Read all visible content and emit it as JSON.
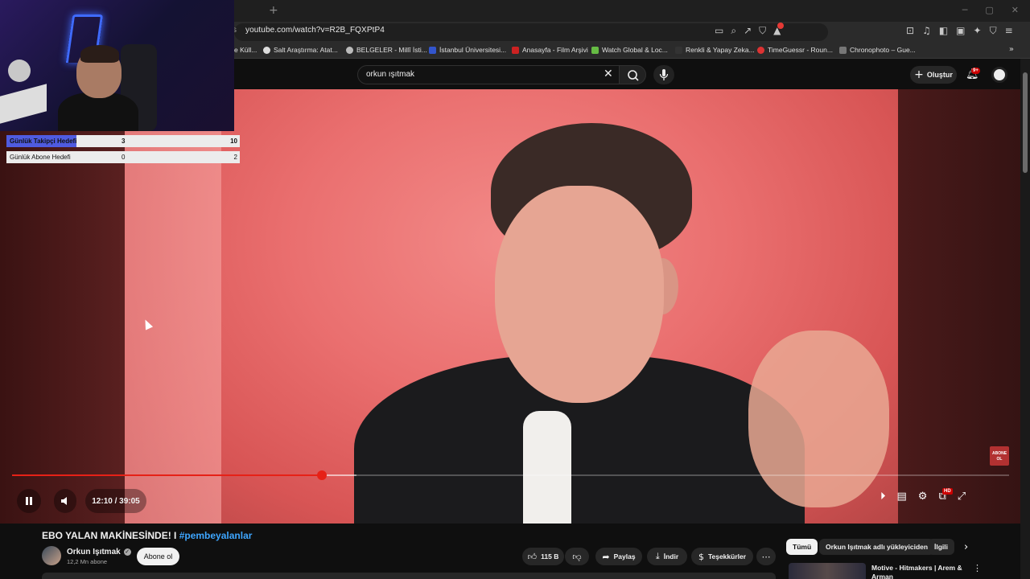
{
  "browser": {
    "url_prefix": "s",
    "url": "youtube.com/watch?v=R2B_FQXPtP4",
    "bookmarks": [
      {
        "label": "e Küll...",
        "color": "#888888"
      },
      {
        "label": "Salt Araştırma: Atat...",
        "color": "#dddddd"
      },
      {
        "label": "BELGELER - Millî İsti...",
        "color": "#bbbbbb"
      },
      {
        "label": "İstanbul Üniversitesi...",
        "color": "#3355cc"
      },
      {
        "label": "Anasayfa - Film Arşivi",
        "color": "#cc2222"
      },
      {
        "label": "Watch Global & Loc...",
        "color": "#66bb44"
      },
      {
        "label": "Renkli & Yapay Zeka...",
        "color": "#333333"
      },
      {
        "label": "TimeGuessr - Roun...",
        "color": "#dd3333"
      },
      {
        "label": "Chronophoto – Gue...",
        "color": "#777777"
      }
    ]
  },
  "youtube": {
    "search_query": "orkun ışıtmak",
    "create_label": "Oluştur",
    "notifications_badge": "9+"
  },
  "overlay": {
    "goals": [
      {
        "label": "Günlük Takipçi Hedefi",
        "current": "3",
        "target": "10",
        "progress": 0.3
      },
      {
        "label": "Günlük Abone Hedefi",
        "current": "0",
        "target": "2",
        "progress": 0
      }
    ]
  },
  "player": {
    "time_display": "12:10 / 39:05",
    "played_fraction": 0.311,
    "quality_badge": "HD",
    "subscribe_watermark": "ABONE OL"
  },
  "video": {
    "title": "EBO YALAN MAKİNESİNDE! I",
    "hashtag": "#pembeyalanlar",
    "channel_name": "Orkun Işıtmak",
    "subscribers": "12,2 Mn abone",
    "subscribe_label": "Abone ol",
    "likes": "115 B",
    "share_label": "Paylaş",
    "download_label": "İndir",
    "thanks_label": "Teşekkürler"
  },
  "sidebar": {
    "chips": [
      "Tümü",
      "Orkun Işıtmak adlı yükleyiciden",
      "İlgili"
    ],
    "recommended_title": "Motive - Hitmakers | Arem & Arman"
  },
  "colors": {
    "accent_red": "#e62117",
    "link_blue": "#3ea6ff",
    "goal_fill": "#4f5be0"
  }
}
